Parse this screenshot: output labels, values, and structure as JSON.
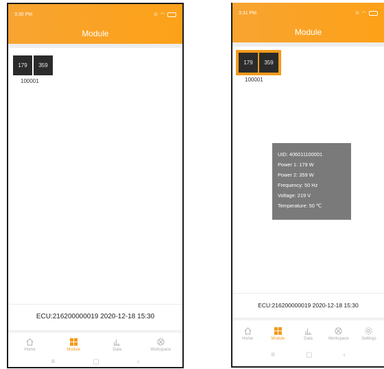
{
  "left": {
    "status_time": "3:30 PM",
    "header_title": "Module",
    "tiles": [
      "179",
      "359"
    ],
    "module_id": "100001",
    "ecu_text": "ECU:216200000019  2020-12-18 15:30",
    "tabs": [
      {
        "label": "Home",
        "icon": "home-icon"
      },
      {
        "label": "Module",
        "icon": "module-grid-icon"
      },
      {
        "label": "Data",
        "icon": "bar-chart-icon"
      },
      {
        "label": "Workspace",
        "icon": "workspace-icon"
      }
    ],
    "nav": [
      "≡",
      "▢",
      "‹"
    ]
  },
  "right": {
    "status_time": "3:31 PM",
    "header_title": "Module",
    "tiles": [
      "179",
      "359"
    ],
    "module_id": "100001",
    "popup": [
      "UID: 406011100001",
      "Power 1: 179 W",
      "Power 2: 359 W",
      "Frequency: 50 Hz",
      "Voltage: 219 V",
      "Temperature: 50 ℃"
    ],
    "ecu_text": "ECU:216200000019  2020-12-18 15:30",
    "tabs": [
      {
        "label": "Home",
        "icon": "home-icon"
      },
      {
        "label": "Module",
        "icon": "module-grid-icon"
      },
      {
        "label": "Data",
        "icon": "bar-chart-icon"
      },
      {
        "label": "Workspace",
        "icon": "workspace-icon"
      },
      {
        "label": "Settings",
        "icon": "gear-icon"
      }
    ],
    "nav": [
      "≡",
      "▢",
      "‹"
    ]
  },
  "colors": {
    "accent": "#f39a1c",
    "tile": "#2b2b2b",
    "popup": "#7a7a7a"
  }
}
